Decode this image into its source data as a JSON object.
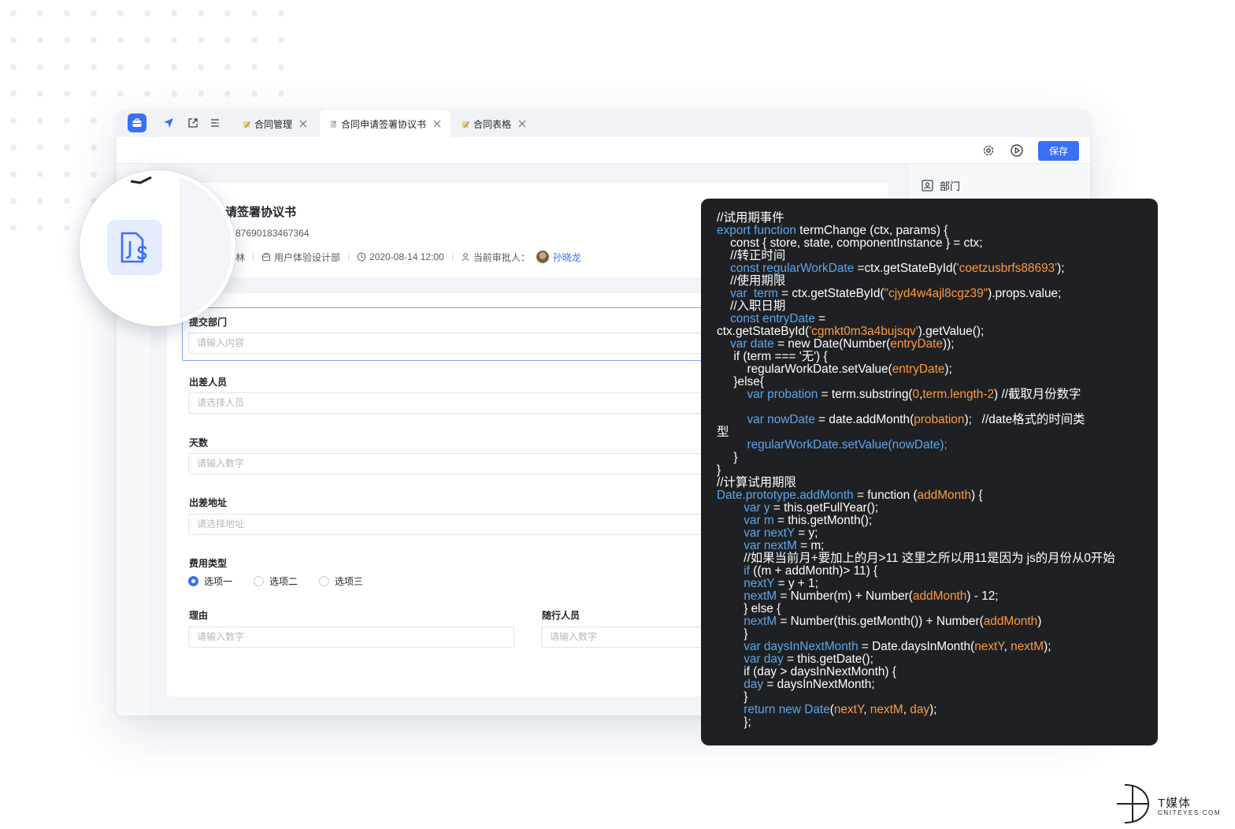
{
  "tabs": [
    {
      "label": "合同管理"
    },
    {
      "label": "合同申请签署协议书"
    },
    {
      "label": "合同表格"
    }
  ],
  "toolbar": {
    "save_label": "保存"
  },
  "right_panel": {
    "item": "部门"
  },
  "header": {
    "title": "请签署协议书",
    "doc_no": "87690183467364",
    "applicant": "林",
    "department": "用户体验设计部",
    "datetime": "2020-08-14 12:00",
    "approver_label": "当前审批人：",
    "approver": "孙晓龙"
  },
  "form": {
    "fields": [
      {
        "label": "提交部门",
        "placeholder": "请输入内容"
      },
      {
        "label": "出差人员",
        "placeholder": "请选择人员"
      },
      {
        "label": "天数",
        "placeholder": "请输入数字"
      },
      {
        "label": "出差地址",
        "placeholder": "请选择地址"
      },
      {
        "label": "费用类型"
      },
      {
        "label": "理由",
        "placeholder": "请输入数字"
      },
      {
        "label": "随行人员",
        "placeholder": "请输入数字"
      }
    ],
    "radio_options": [
      "选项一",
      "选项二",
      "选项三"
    ],
    "radio_selected": 0
  },
  "watermark": {
    "brand": "T媒体",
    "site": "CNITEYES.COM"
  },
  "colors": {
    "accent": "#3a6ff7",
    "code_bg": "#1f2023",
    "code_keyword": "#5ba7ec",
    "code_string": "#ff9b3d"
  },
  "code_lines": [
    [
      [
        "w",
        "//试用期事件"
      ]
    ],
    [
      [
        "k",
        "export function "
      ],
      [
        "w",
        "termChange (ctx, params) {"
      ]
    ],
    [
      [
        "w",
        "    const { store, state, componentInstance } = ctx;"
      ]
    ],
    [
      [
        "w",
        "    //转正时间"
      ]
    ],
    [
      [
        "k",
        "    const regularWorkDate "
      ],
      [
        "w",
        "=ctx.getStateById("
      ],
      [
        "s",
        "'coetzusbrfs88693'"
      ],
      [
        "w",
        ");"
      ]
    ],
    [
      [
        "w",
        "    //使用期限"
      ]
    ],
    [
      [
        "k",
        "    var  term "
      ],
      [
        "w",
        "= ctx.getStateById("
      ],
      [
        "s",
        "\"cjyd4w4ajl8cgz39\""
      ],
      [
        "w",
        ").props.value;"
      ]
    ],
    [
      [
        "w",
        "    //入职日期"
      ]
    ],
    [
      [
        "k",
        "    const entryDate "
      ],
      [
        "w",
        "="
      ]
    ],
    [
      [
        "w",
        "ctx.getStateById("
      ],
      [
        "s",
        "'cgmkt0m3a4bujsqv'"
      ],
      [
        "w",
        ").getValue();"
      ]
    ],
    [
      [
        "k",
        "    var date "
      ],
      [
        "w",
        "= new Date(Number("
      ],
      [
        "s",
        "entryDate"
      ],
      [
        "w",
        "));"
      ]
    ],
    [
      [
        "w",
        "     if (term === '无') {"
      ]
    ],
    [
      [
        "w",
        "         regularWorkDate.setValue("
      ],
      [
        "s",
        "entryDate"
      ],
      [
        "w",
        ");"
      ]
    ],
    [
      [
        "w",
        "     }else{"
      ]
    ],
    [
      [
        "k",
        "         var probation "
      ],
      [
        "w",
        "= term.substring("
      ],
      [
        "s",
        "0"
      ],
      [
        "w",
        ","
      ],
      [
        "s",
        "term.length-2"
      ],
      [
        "w",
        ") //截取月份数字"
      ]
    ],
    [
      [
        "w",
        ""
      ]
    ],
    [
      [
        "k",
        "         var nowDate "
      ],
      [
        "w",
        "= date.addMonth("
      ],
      [
        "s",
        "probation"
      ],
      [
        "w",
        ");   //date格式的时间类"
      ]
    ],
    [
      [
        "w",
        "型"
      ]
    ],
    [
      [
        "k",
        "         regularWorkDate.setValue(nowDate);"
      ]
    ],
    [
      [
        "w",
        "     }"
      ]
    ],
    [
      [
        "w",
        "}"
      ]
    ],
    [
      [
        "w",
        "//计算试用期限"
      ]
    ],
    [
      [
        "k",
        "Date.prototype.addMonth "
      ],
      [
        "w",
        "= function ("
      ],
      [
        "s",
        "addMonth"
      ],
      [
        "w",
        ") {"
      ]
    ],
    [
      [
        "k",
        "        var y "
      ],
      [
        "w",
        "= this.getFullYear();"
      ]
    ],
    [
      [
        "k",
        "        var m "
      ],
      [
        "w",
        "= this.getMonth();"
      ]
    ],
    [
      [
        "k",
        "        var nextY "
      ],
      [
        "w",
        "= y;"
      ]
    ],
    [
      [
        "k",
        "        var nextM "
      ],
      [
        "w",
        "= m;"
      ]
    ],
    [
      [
        "w",
        "        //如果当前月+要加上的月>11 这里之所以用11是因为 js的月份从0开始"
      ]
    ],
    [
      [
        "k",
        "        if "
      ],
      [
        "w",
        "((m + addMonth)> 11) {"
      ]
    ],
    [
      [
        "k",
        "        nextY "
      ],
      [
        "w",
        "= y + 1;"
      ]
    ],
    [
      [
        "k",
        "        nextM "
      ],
      [
        "w",
        "= Number(m) + Number("
      ],
      [
        "s",
        "addMonth"
      ],
      [
        "w",
        ") - 12;"
      ]
    ],
    [
      [
        "w",
        "        } else {"
      ]
    ],
    [
      [
        "k",
        "        nextM "
      ],
      [
        "w",
        "= Number(this.getMonth()) + Number("
      ],
      [
        "s",
        "addMonth"
      ],
      [
        "w",
        ")"
      ]
    ],
    [
      [
        "w",
        "        }"
      ]
    ],
    [
      [
        "k",
        "        var daysInNextMonth "
      ],
      [
        "w",
        "= Date.daysInMonth("
      ],
      [
        "s",
        "nextY"
      ],
      [
        "w",
        ", "
      ],
      [
        "s",
        "nextM"
      ],
      [
        "w",
        ");"
      ]
    ],
    [
      [
        "k",
        "        var day "
      ],
      [
        "w",
        "= this.getDate();"
      ]
    ],
    [
      [
        "w",
        "        if (day > daysInNextMonth) {"
      ]
    ],
    [
      [
        "k",
        "        day "
      ],
      [
        "w",
        "= daysInNextMonth;"
      ]
    ],
    [
      [
        "w",
        "        }"
      ]
    ],
    [
      [
        "k",
        "        return new Date"
      ],
      [
        "w",
        "("
      ],
      [
        "s",
        "nextY"
      ],
      [
        "w",
        ", "
      ],
      [
        "s",
        "nextM"
      ],
      [
        "w",
        ", "
      ],
      [
        "s",
        "day"
      ],
      [
        "w",
        ");"
      ]
    ],
    [
      [
        "w",
        "        };"
      ]
    ]
  ]
}
